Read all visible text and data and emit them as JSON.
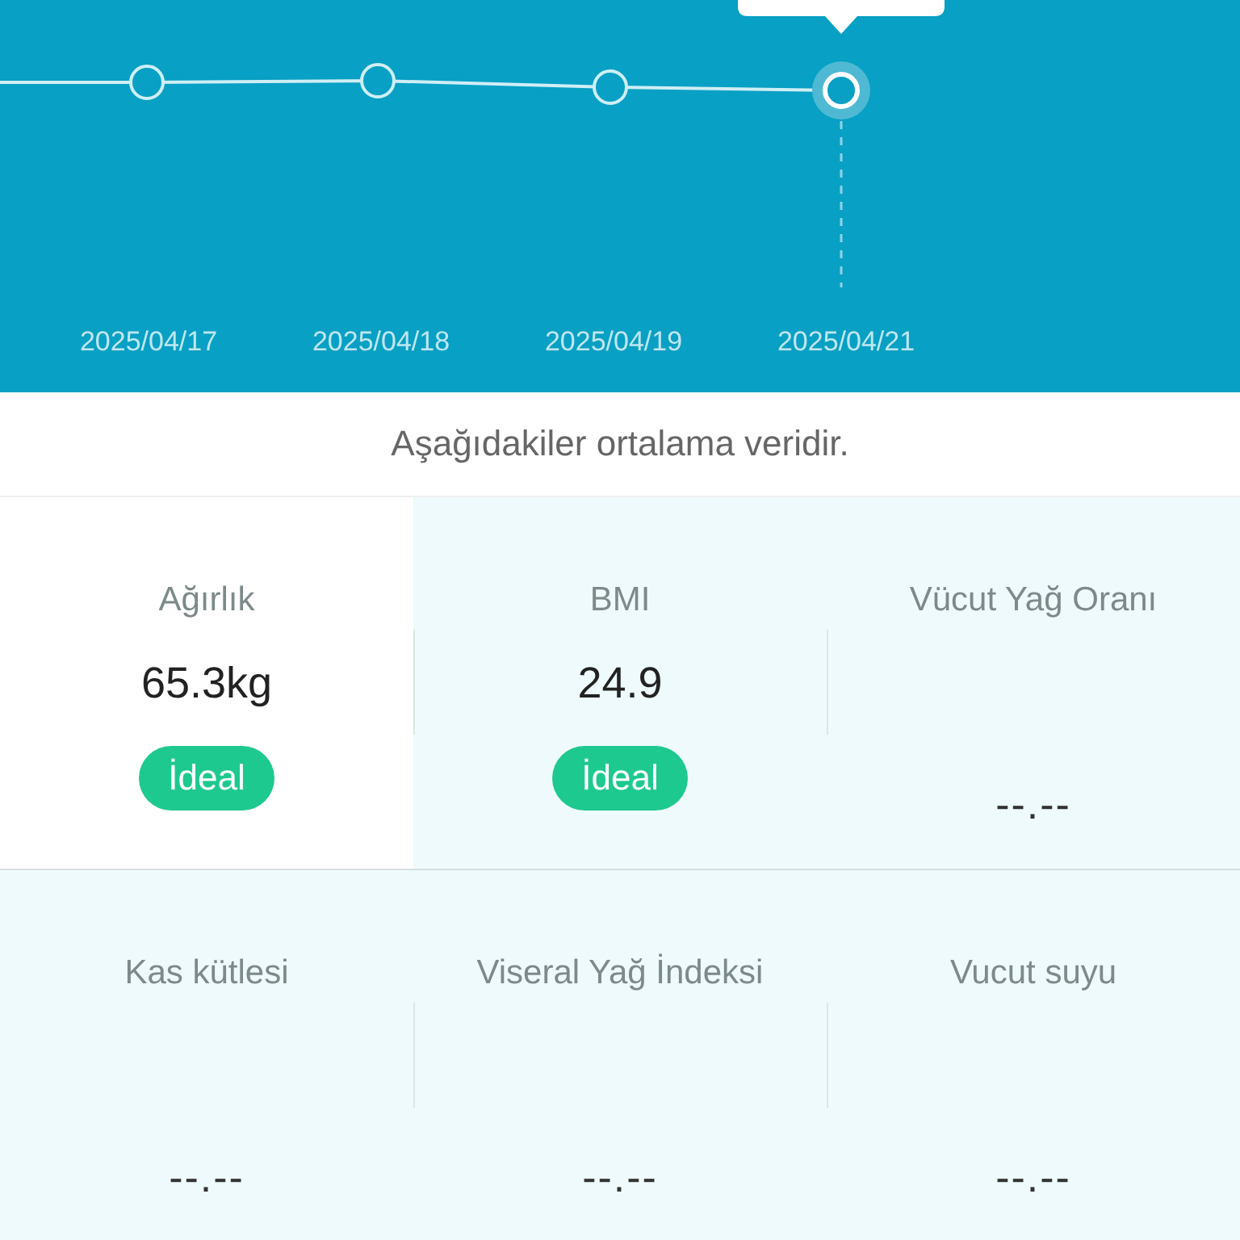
{
  "chart": {
    "points": [
      {
        "x_label": "2025/04/17",
        "selected": false
      },
      {
        "x_label": "2025/04/18",
        "selected": false
      },
      {
        "x_label": "2025/04/19",
        "selected": false
      },
      {
        "x_label": "2025/04/21",
        "selected": true
      }
    ]
  },
  "caption": "Aşağıdakiler ortalama veridir.",
  "metrics": [
    {
      "label": "Ağırlık",
      "value": "65.3kg",
      "badge": "İdeal",
      "selected": true
    },
    {
      "label": "BMI",
      "value": "24.9",
      "badge": "İdeal",
      "selected": false
    },
    {
      "label": "Vücut Yağ Oranı",
      "value": "--.--",
      "selected": false
    },
    {
      "label": "Kas kütlesi",
      "value": "--.--",
      "selected": false
    },
    {
      "label": "Viseral Yağ İndeksi",
      "value": "--.--",
      "selected": false
    },
    {
      "label": "Vucut suyu",
      "value": "--.--",
      "selected": false
    }
  ]
}
